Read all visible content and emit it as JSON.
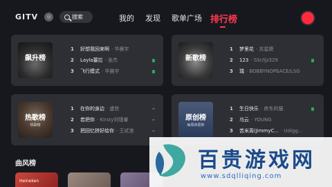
{
  "app": {
    "logo": "GITV",
    "badge": "◎"
  },
  "search": {
    "label": "搜索",
    "icon": "search-icon"
  },
  "nav": {
    "items": [
      {
        "label": "我的",
        "active": false
      },
      {
        "label": "发现",
        "active": false
      },
      {
        "label": "歌单广场",
        "active": false
      },
      {
        "label": "排行榜",
        "active": true
      }
    ],
    "accent": "#ff3a4d"
  },
  "charts": [
    {
      "name": "飙升榜",
      "cover_sub": "",
      "songs": [
        {
          "rank": "1",
          "title": "好想我回来啊",
          "artist": "· 华晨宇",
          "tag": ""
        },
        {
          "rank": "2",
          "title": "Layla蕾拉",
          "artist": "· 张杰",
          "tag": "green"
        },
        {
          "rank": "3",
          "title": "飞行模式",
          "artist": "· 华晨宇",
          "tag": "green"
        }
      ]
    },
    {
      "name": "新歌榜",
      "cover_sub": "",
      "songs": [
        {
          "rank": "1",
          "title": "梦里花",
          "artist": "· 苏星婕",
          "tag": ""
        },
        {
          "rank": "2",
          "title": "123",
          "artist": "· SSr/ljz329",
          "tag": "green"
        },
        {
          "rank": "3",
          "title": "瑞",
          "artist": "· BOBBYNOPEACE/LSG",
          "tag": ""
        }
      ]
    },
    {
      "name": "热歌榜",
      "cover_sub": "热歌榜",
      "songs": [
        {
          "rank": "1",
          "title": "在你的身边",
          "artist": "· 盛哲",
          "tag": "gray"
        },
        {
          "rank": "2",
          "title": "若把你",
          "artist": "· Kirsty刘瑾睿",
          "tag": "gray"
        },
        {
          "rank": "3",
          "title": "把回忆拼好给你",
          "artist": "· 王贰浪",
          "tag": "gray"
        }
      ]
    },
    {
      "name": "原创榜",
      "cover_sub": "每周四更新",
      "songs": [
        {
          "rank": "1",
          "title": "生日快乐",
          "artist": "· 房东的猫",
          "tag": "green"
        },
        {
          "rank": "2",
          "title": "乌云",
          "artist": "· YOUNG",
          "tag": ""
        },
        {
          "rank": "3",
          "title": "苦米周(JimmyC...",
          "artist": "· Udigg...",
          "tag": "gray"
        }
      ]
    }
  ],
  "section": {
    "title": "曲风榜"
  },
  "genres": [
    {
      "label": "Heineken"
    },
    {
      "label": ""
    },
    {
      "label": ""
    }
  ],
  "watermark": {
    "text": "百贵游戏网",
    "url": "www.sdqlliqing.com"
  }
}
